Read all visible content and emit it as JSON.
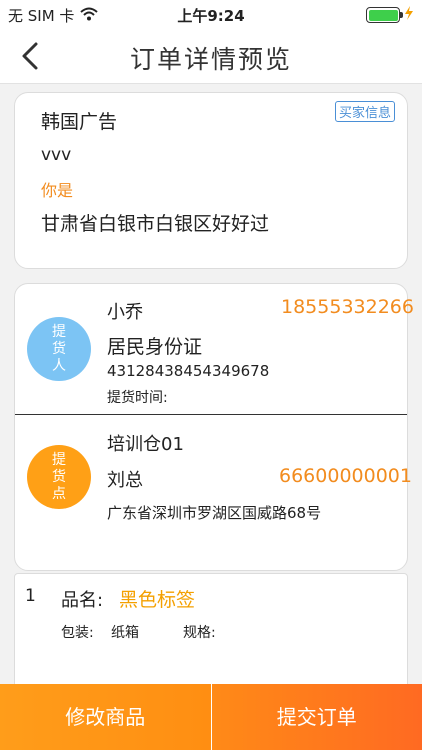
{
  "status": {
    "carrier": "无 SIM 卡",
    "time": "上午9:24",
    "wifi_icon": "wifi-icon",
    "battery_level": 1.0,
    "charging_icon": "bolt-icon"
  },
  "nav": {
    "title": "订单详情预览",
    "back_icon": "chevron-left-icon"
  },
  "buyer": {
    "tag": "买家信息",
    "name": "韩国广告",
    "id": "vvv",
    "note": "你是",
    "address": "甘肃省白银市白银区好好过"
  },
  "pickup_person": {
    "circle_label": "提货人",
    "name": "小乔",
    "phone": "18555332266",
    "id_type": "居民身份证",
    "id_number": "431284384543496​78",
    "time_label": "提货时间:"
  },
  "pickup_point": {
    "circle_label": "提货点",
    "warehouse": "培训仓01",
    "contact": "刘总",
    "phone": "66600000001",
    "address": "广东省深圳市罗湖区国威路68号"
  },
  "goods": {
    "index": "1",
    "name_label": "品名:",
    "name_value": "黑色标签",
    "pack_label": "包装:",
    "pack_value": "纸箱",
    "spec_label": "规格:"
  },
  "actions": {
    "edit_label": "修改商品",
    "submit_label": "提交订单"
  },
  "colors": {
    "accent": "#f28c1f",
    "blue_circle": "#7cc4f4",
    "orange_circle": "#ffa016",
    "link_blue": "#4a8fd6"
  }
}
